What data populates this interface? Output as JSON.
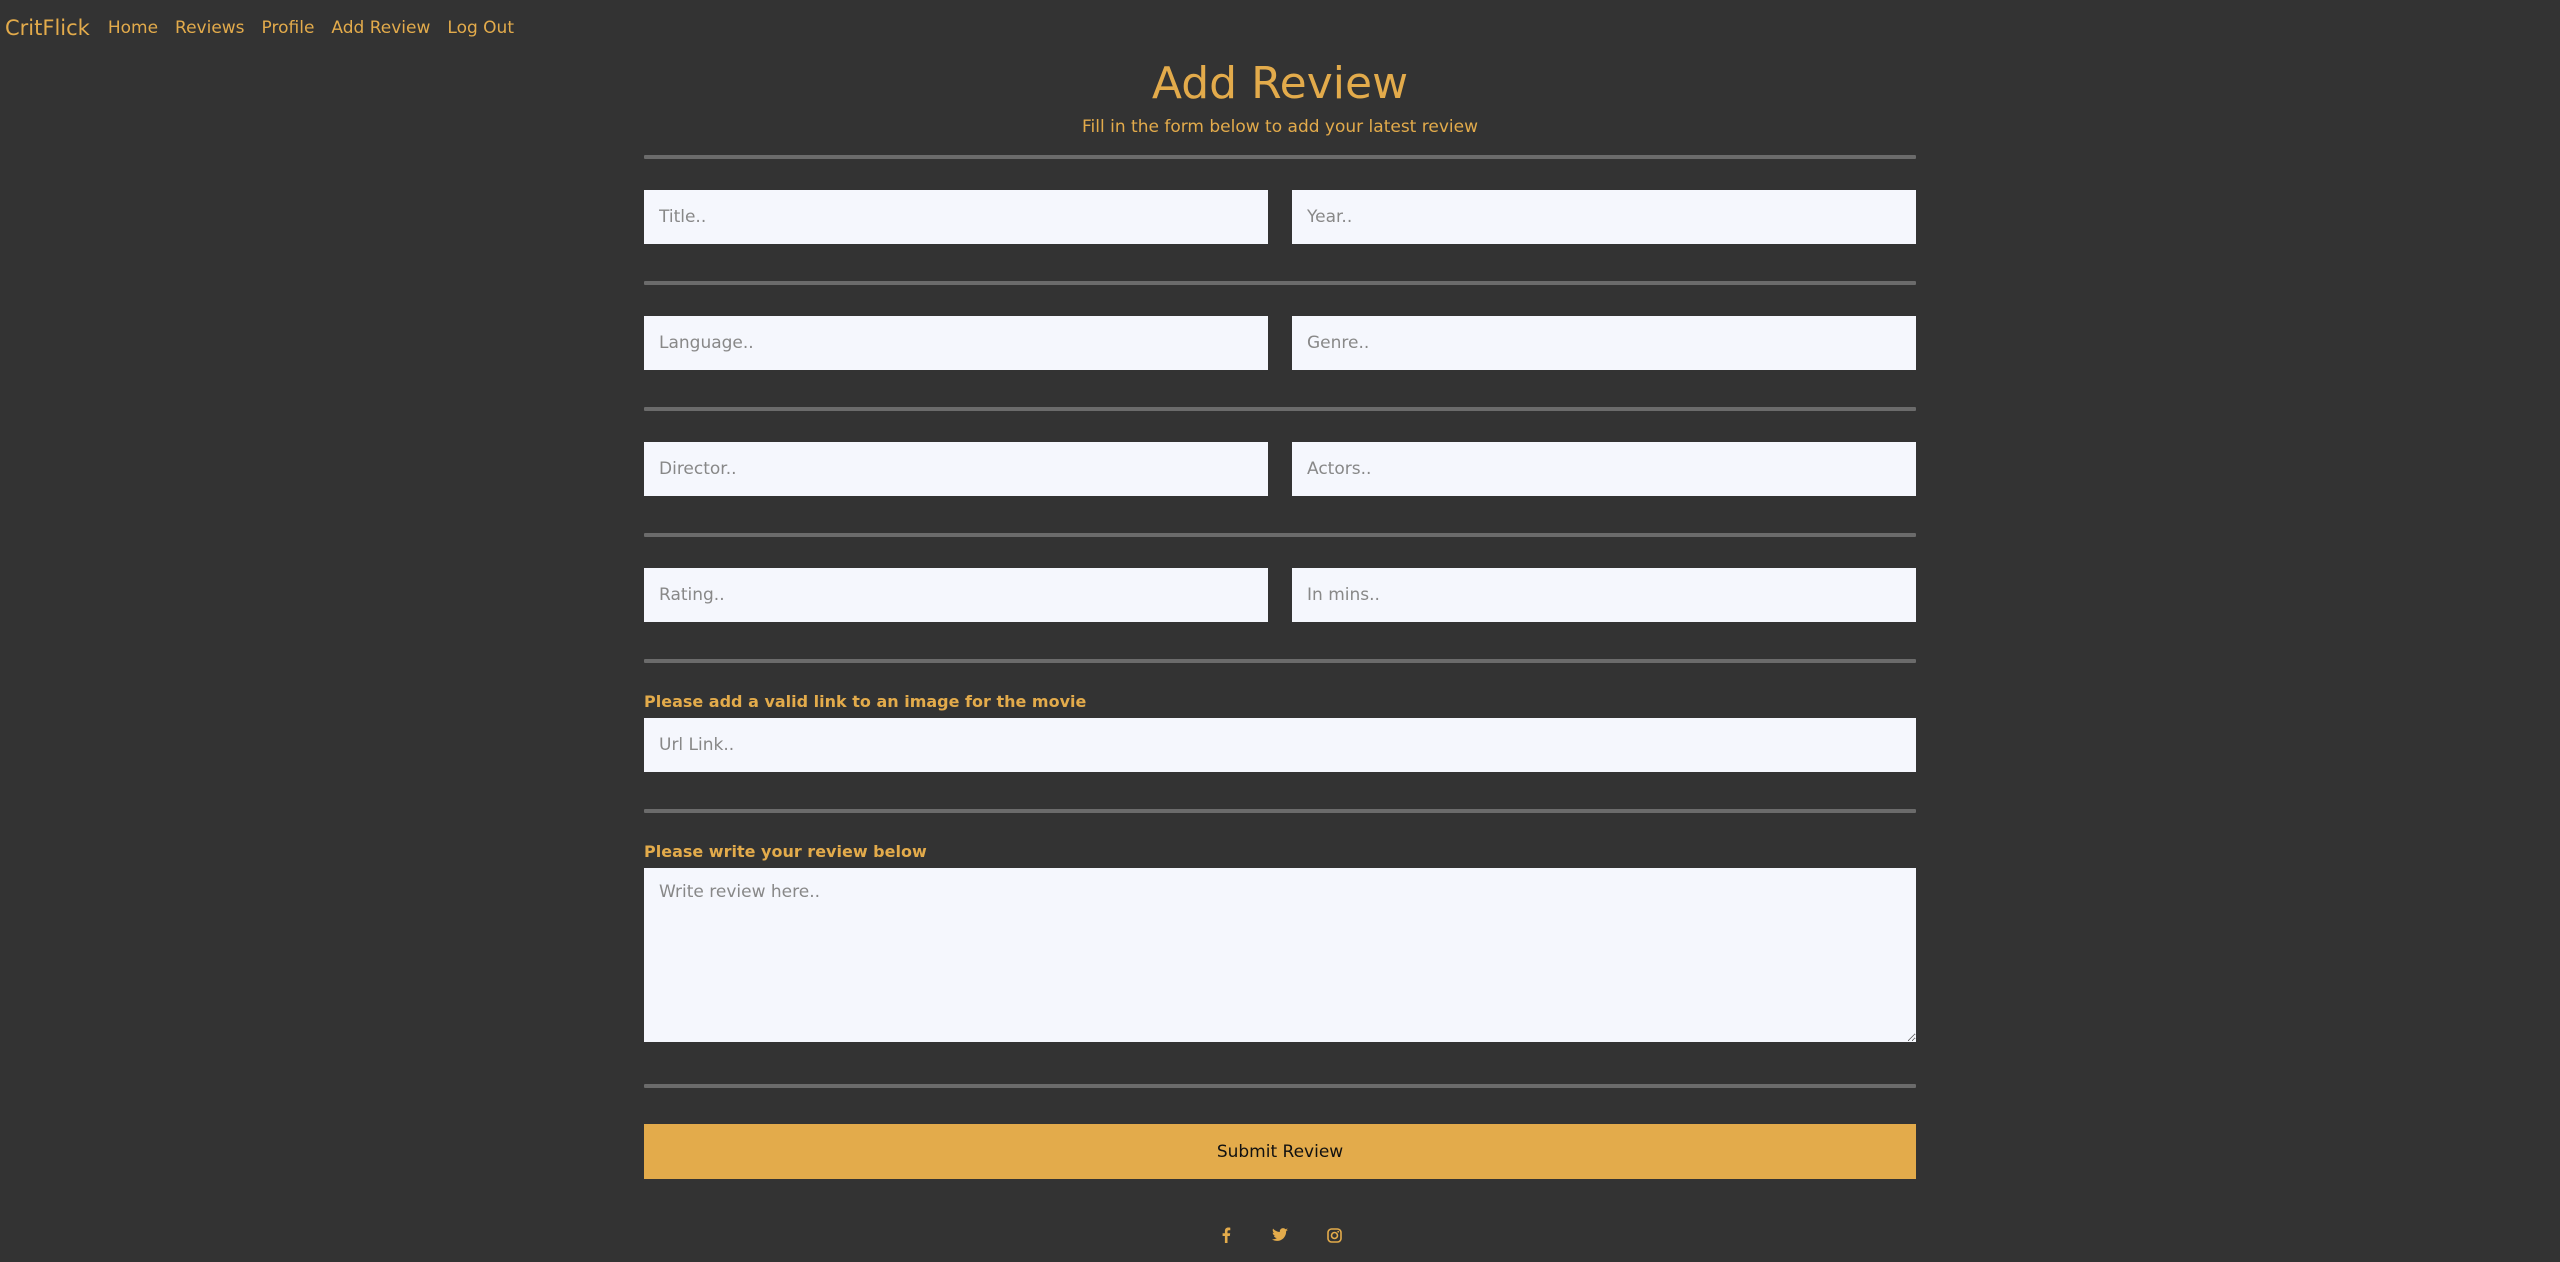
{
  "nav": {
    "brand": "CritFlick",
    "links": [
      "Home",
      "Reviews",
      "Profile",
      "Add Review",
      "Log Out"
    ]
  },
  "header": {
    "title": "Add Review",
    "subtitle": "Fill in the form below to add your latest review"
  },
  "form": {
    "title_placeholder": "Title..",
    "year_placeholder": "Year..",
    "language_placeholder": "Language..",
    "genre_placeholder": "Genre..",
    "director_placeholder": "Director..",
    "actors_placeholder": "Actors..",
    "rating_placeholder": "Rating..",
    "runtime_placeholder": "In mins..",
    "image_label": "Please add a valid link to an image for the movie",
    "url_placeholder": "Url Link..",
    "review_label": "Please write your review below",
    "review_placeholder": "Write review here..",
    "submit_label": "Submit Review"
  },
  "social": {
    "icons": [
      "facebook-icon",
      "twitter-icon",
      "instagram-icon"
    ]
  },
  "colors": {
    "accent": "#e3ab4b",
    "background": "#333333",
    "field": "#f5f7fd"
  }
}
